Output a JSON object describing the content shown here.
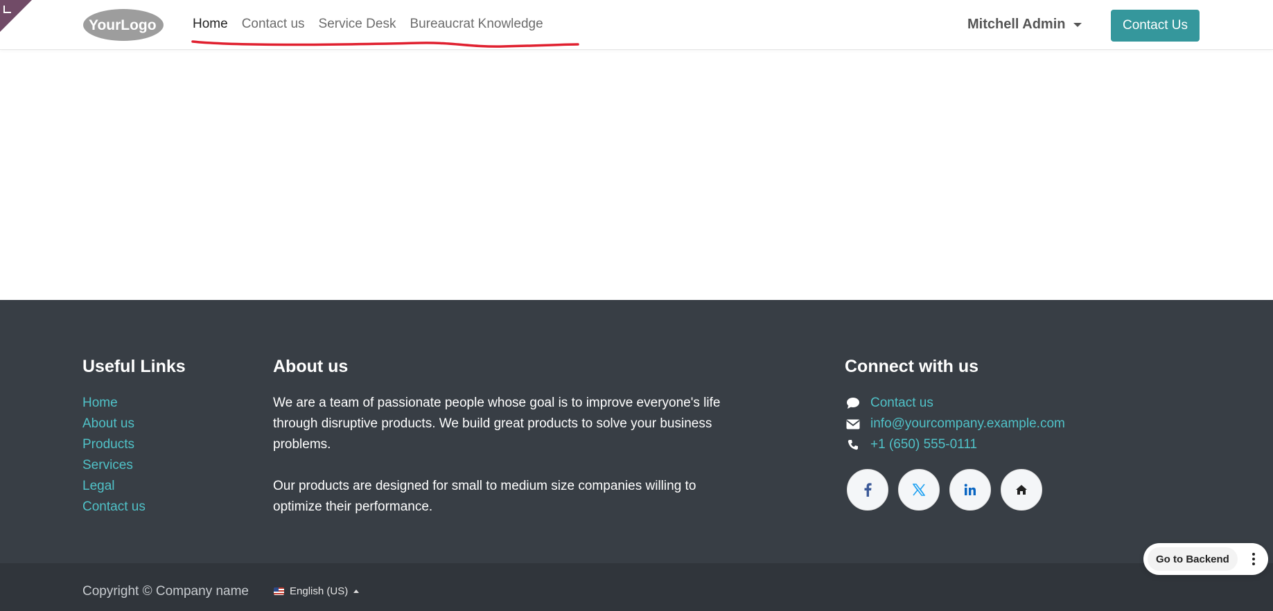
{
  "header": {
    "logo_text": "YourLogo",
    "nav": [
      "Home",
      "Contact us",
      "Service Desk",
      "Bureaucrat Knowledge"
    ],
    "active_nav": "Home",
    "user_name": "Mitchell Admin",
    "cta_label": "Contact Us"
  },
  "footer": {
    "useful_links_title": "Useful Links",
    "useful_links": [
      "Home",
      "About us",
      "Products",
      "Services",
      "Legal",
      "Contact us"
    ],
    "about_title": "About us",
    "about_p1": "We are a team of passionate people whose goal is to improve everyone's life through disruptive products. We build great products to solve your business problems.",
    "about_p2": "Our products are designed for small to medium size companies willing to optimize their performance.",
    "connect_title": "Connect with us",
    "connect_items": [
      {
        "icon": "comment-icon",
        "text": "Contact us"
      },
      {
        "icon": "envelope-icon",
        "text": "info@yourcompany.example.com"
      },
      {
        "icon": "phone-icon",
        "text": "+1 (650) 555-0111"
      }
    ],
    "socials": [
      "facebook-icon",
      "x-twitter-icon",
      "linkedin-icon",
      "home-icon"
    ]
  },
  "bottom": {
    "copyright": "Copyright © Company name",
    "language": "English (US)"
  },
  "backend": {
    "label": "Go to Backend"
  },
  "colors": {
    "accent": "#35979c",
    "link": "#50c2c8",
    "footer_bg": "#383e45",
    "annotation": "#e0202f"
  }
}
